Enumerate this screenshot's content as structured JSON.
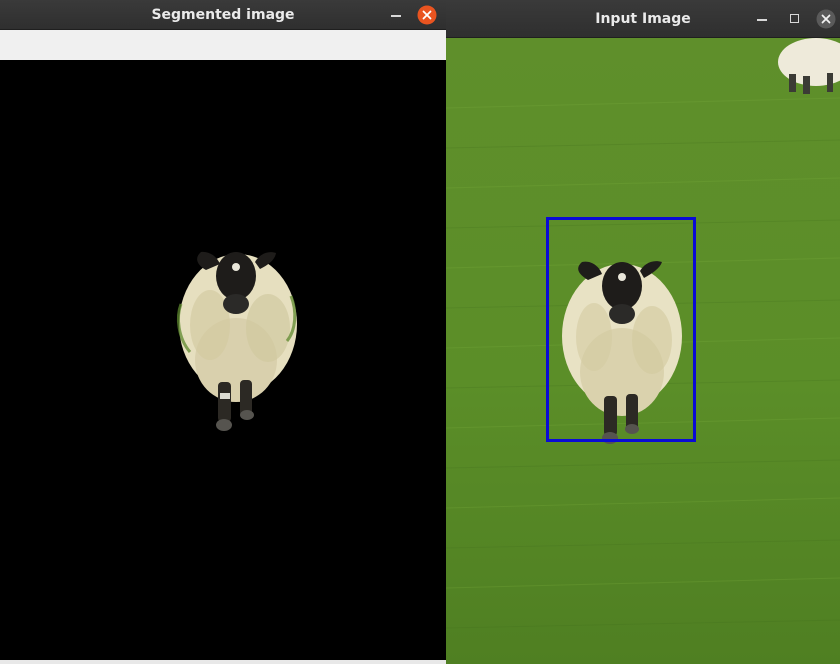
{
  "windows": {
    "segmented": {
      "title": "Segmented image",
      "minimize_label": "–",
      "close_label": "close"
    },
    "input": {
      "title": "Input Image",
      "minimize_label": "–",
      "maximize_label": "□",
      "close_label": "close"
    }
  },
  "colors": {
    "titlebar_bg": "#2f2f2f",
    "titlebar_text": "#eaeaea",
    "close_accent": "#e95420",
    "bbox_color": "#0a0bd6",
    "grass": "#5c8d2b",
    "segmented_bg": "#000000"
  },
  "icons": {
    "segmented_min": "minimize-icon",
    "segmented_close": "close-icon",
    "input_min": "minimize-icon",
    "input_max": "maximize-icon",
    "input_close": "close-icon"
  }
}
